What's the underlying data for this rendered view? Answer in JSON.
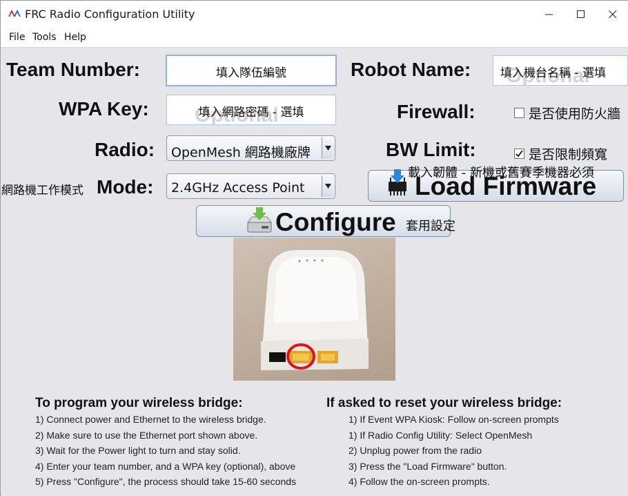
{
  "window": {
    "title": "FRC Radio Configuration Utility"
  },
  "menu": [
    "File",
    "Tools",
    "Help"
  ],
  "form": {
    "team_number_label": "Team Number:",
    "team_number_value": "填入隊伍編號",
    "robot_name_label": "Robot Name:",
    "robot_name_placeholder": "Optional",
    "robot_name_value": "填入機台名稱 - 選填",
    "wpa_key_label": "WPA Key:",
    "wpa_key_placeholder": "Optional",
    "wpa_key_value": "填入網路密碼 - 選填",
    "firewall_label": "Firewall:",
    "firewall_checkbox_label": "是否使用防火牆",
    "firewall_checked": false,
    "radio_label": "Radio:",
    "radio_value": "OpenMesh 網路機廠牌",
    "bw_limit_label": "BW Limit:",
    "bw_limit_checkbox_label": "是否限制頻寬",
    "bw_limit_checked": true,
    "mode_prefix": "網路機工作模式",
    "mode_label": "Mode:",
    "mode_value": "2.4GHz Access Point"
  },
  "buttons": {
    "load_firmware_note": "載入韌體 - 新機或舊賽季機器必須",
    "load_firmware_label": "Load Firmware",
    "configure_label": "Configure",
    "configure_note": "套用設定"
  },
  "instructions_left": {
    "heading": "To program your wireless bridge:",
    "steps": [
      "1) Connect power and Ethernet to the wireless bridge.",
      "2) Make sure to use the Ethernet port shown above.",
      "3) Wait for the Power light to turn and stay solid.",
      "4) Enter your team number, and a WPA key (optional), above",
      "5) Press \"Configure\", the process should take 15-60 seconds"
    ]
  },
  "instructions_right": {
    "heading": "If asked to reset your wireless bridge:",
    "steps": [
      "1) If Event WPA Kiosk: Follow on-screen prompts",
      "1) If Radio Config Utility: Select OpenMesh",
      "2) Unplug power from the radio",
      "3) Press the \"Load Firmware\" button.",
      "4) Follow the on-screen prompts."
    ]
  },
  "icons": {
    "app": "frc-logo-icon",
    "minimize": "minimize-icon",
    "maximize": "maximize-icon",
    "close": "close-icon",
    "load_firmware": "chip-download-icon",
    "configure": "drive-download-icon"
  }
}
